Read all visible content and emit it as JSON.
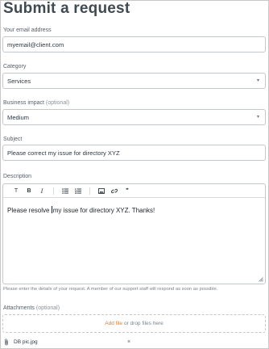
{
  "page": {
    "title": "Submit a request"
  },
  "email": {
    "label": "Your email address",
    "value": "myemail@client.com"
  },
  "category": {
    "label": "Category",
    "value": "Services",
    "caret": "▾"
  },
  "impact": {
    "label": "Business impact",
    "optional": "(optional)",
    "value": "Medium",
    "caret": "▾"
  },
  "subject": {
    "label": "Subject",
    "value": "Please correct my issue for directory XYZ"
  },
  "description": {
    "label": "Description",
    "toolbar": {
      "text_style": "T",
      "bold": "B",
      "italic": "I",
      "quote": "❞"
    },
    "text_before_cursor": "Please resolve ",
    "text_after_cursor": "my issue for directory XYZ.  Thanks!",
    "hint": "Please enter the details of your request. A member of our support staff will respond as soon as possible."
  },
  "attachments": {
    "label": "Attachments",
    "optional": "(optional)",
    "add_file": "Add file",
    "drop_text": "or drop files here",
    "files": [
      {
        "name": "DB pic.jpg",
        "remove": "×"
      }
    ]
  },
  "colors": {
    "link_accent": "#e07b2a",
    "border": "#c2c8cc",
    "title": "#3f4a51"
  },
  "icons": [
    "bulleted-list-icon",
    "numbered-list-icon",
    "image-icon",
    "link-icon",
    "quote-icon",
    "paperclip-icon",
    "close-icon",
    "resize-handle-icon"
  ]
}
